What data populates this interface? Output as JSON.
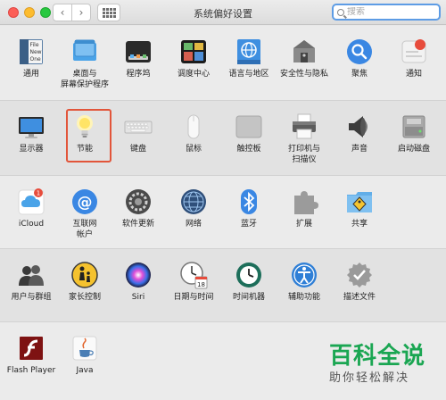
{
  "window": {
    "title": "系统偏好设置",
    "search_placeholder": "搜索"
  },
  "sections": [
    {
      "items": [
        {
          "label": "通用",
          "icon": "general-icon"
        },
        {
          "label": "桌面与\n屏幕保护程序",
          "icon": "desktop-icon"
        },
        {
          "label": "程序坞",
          "icon": "dock-icon"
        },
        {
          "label": "调度中心",
          "icon": "mission-control-icon"
        },
        {
          "label": "语言与地区",
          "icon": "language-icon"
        },
        {
          "label": "安全性与隐私",
          "icon": "security-icon"
        },
        {
          "label": "聚焦",
          "icon": "spotlight-icon"
        },
        {
          "label": "通知",
          "icon": "notifications-icon"
        }
      ]
    },
    {
      "items": [
        {
          "label": "显示器",
          "icon": "display-icon"
        },
        {
          "label": "节能",
          "icon": "energy-saver-icon"
        },
        {
          "label": "键盘",
          "icon": "keyboard-icon"
        },
        {
          "label": "鼠标",
          "icon": "mouse-icon"
        },
        {
          "label": "触控板",
          "icon": "trackpad-icon"
        },
        {
          "label": "打印机与\n扫描仪",
          "icon": "printer-icon"
        },
        {
          "label": "声音",
          "icon": "sound-icon"
        },
        {
          "label": "启动磁盘",
          "icon": "startup-disk-icon"
        }
      ]
    },
    {
      "items": [
        {
          "label": "iCloud",
          "icon": "icloud-icon",
          "badge": "1"
        },
        {
          "label": "互联网\n帐户",
          "icon": "internet-accounts-icon"
        },
        {
          "label": "软件更新",
          "icon": "software-update-icon"
        },
        {
          "label": "网络",
          "icon": "network-icon"
        },
        {
          "label": "蓝牙",
          "icon": "bluetooth-icon"
        },
        {
          "label": "扩展",
          "icon": "extensions-icon"
        },
        {
          "label": "共享",
          "icon": "sharing-icon"
        }
      ]
    },
    {
      "items": [
        {
          "label": "用户与群组",
          "icon": "users-icon"
        },
        {
          "label": "家长控制",
          "icon": "parental-controls-icon"
        },
        {
          "label": "Siri",
          "icon": "siri-icon"
        },
        {
          "label": "日期与时间",
          "icon": "date-time-icon"
        },
        {
          "label": "时间机器",
          "icon": "time-machine-icon"
        },
        {
          "label": "辅助功能",
          "icon": "accessibility-icon"
        },
        {
          "label": "描述文件",
          "icon": "profiles-icon"
        }
      ]
    },
    {
      "items": [
        {
          "label": "Flash Player",
          "icon": "flash-player-icon"
        },
        {
          "label": "Java",
          "icon": "java-icon"
        }
      ]
    }
  ],
  "calendar_day": "18",
  "desktop_icon_text": {
    "line1": "File",
    "line2": "New",
    "line3": "One"
  },
  "watermark": {
    "title": "百科全说",
    "subtitle": "助你轻松解决"
  }
}
